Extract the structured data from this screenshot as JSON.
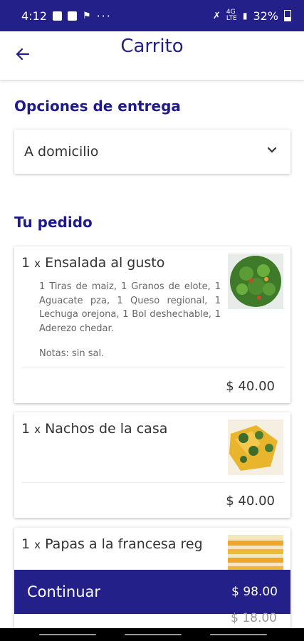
{
  "status_bar": {
    "time": "4:12",
    "battery": "32%"
  },
  "header": {
    "title": "Carrito"
  },
  "delivery": {
    "heading": "Opciones de entrega",
    "selected": "A domicilio"
  },
  "order": {
    "heading": "Tu pedido",
    "items": [
      {
        "qty": "1",
        "x": "x",
        "name": "Ensalada al gusto",
        "description": "1 Tiras de maiz, 1 Granos de elote, 1 Aguacate pza, 1 Queso regional, 1 Lechuga orejona, 1 Bol deshechable, 1 Aderezo chedar.",
        "notes": "Notas: sin sal.",
        "price": "$ 40.00"
      },
      {
        "qty": "1",
        "x": "x",
        "name": "Nachos de la casa",
        "price": "$ 40.00"
      },
      {
        "qty": "1",
        "x": "x",
        "name": "Papas a la francesa reg",
        "price": "$ 18.00"
      }
    ]
  },
  "footer": {
    "continue_label": "Continuar",
    "total": "$ 98.00"
  },
  "colors": {
    "primary": "#23208a",
    "heading": "#1e1a8e"
  }
}
